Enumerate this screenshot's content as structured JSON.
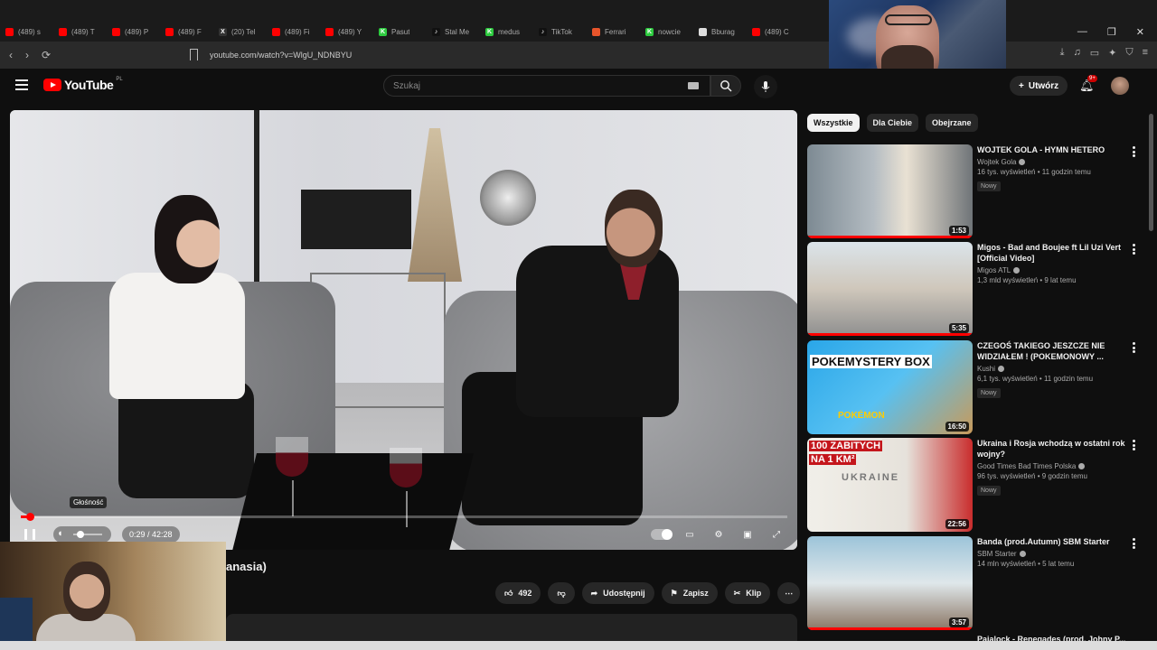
{
  "browser": {
    "tabs": [
      {
        "label": "(489) s",
        "color": "#ff0000"
      },
      {
        "label": "(489) T",
        "color": "#ff0000"
      },
      {
        "label": "(489) P",
        "color": "#ff0000"
      },
      {
        "label": "(489) F",
        "color": "#ff0000"
      },
      {
        "label": "(20) Tel",
        "color": "#333333",
        "glyph": "X"
      },
      {
        "label": "(489) Fi",
        "color": "#ff0000"
      },
      {
        "label": "(489) Y",
        "color": "#ff0000"
      },
      {
        "label": "Pasut",
        "color": "#2ecc40",
        "glyph": "K"
      },
      {
        "label": "Stal Me",
        "color": "#111111",
        "glyph": "♪"
      },
      {
        "label": "medus",
        "color": "#2ecc40",
        "glyph": "K"
      },
      {
        "label": "TikTok",
        "color": "#111111",
        "glyph": "♪"
      },
      {
        "label": "Ferrari",
        "color": "#e8552b"
      },
      {
        "label": "nowcie",
        "color": "#2ecc40",
        "glyph": "K"
      },
      {
        "label": "Bburag",
        "color": "#dddddd"
      },
      {
        "label": "(489) C",
        "color": "#ff0000"
      }
    ],
    "url": "youtube.com/watch?v=WlgU_NDNBYU"
  },
  "header": {
    "logo_text": "YouTube",
    "logo_country": "PL",
    "search_placeholder": "Szukaj",
    "create_label": "Utwórz",
    "notif_count": "9+"
  },
  "player": {
    "time": "0:29 / 42:28",
    "progress_fraction": 0.0114,
    "volume_tooltip": "Głośność"
  },
  "video": {
    "title_fragment": "anasia)",
    "likes": "492",
    "share_label": "Udostępnij",
    "save_label": "Zapisz",
    "clip_label": "Klip"
  },
  "sidebar": {
    "chips": [
      "Wszystkie",
      "Dla Ciebie",
      "Obejrzane"
    ],
    "recs": [
      {
        "title": "WOJTEK GOLA - HYMN HETERO",
        "channel": "Wojtek Gola",
        "meta": "16 tys. wyświetleń • 11 godzin temu",
        "badge": "Nowy",
        "duration": "1:53",
        "watched": 1.0,
        "thumb": "a"
      },
      {
        "title": "Migos - Bad and Boujee ft Lil Uzi Vert [Official Video]",
        "channel": "Migos ATL",
        "meta": "1,3 mld wyświetleń • 9 lat temu",
        "badge": "",
        "duration": "5:35",
        "watched": 1.0,
        "thumb": "b"
      },
      {
        "title": "CZEGOŚ TAKIEGO JESZCZE NIE WIDZIAŁEM ! (POKEMONOWY ...",
        "channel": "Kushi",
        "meta": "6,1 tys. wyświetleń • 11 godzin temu",
        "badge": "Nowy",
        "duration": "16:50",
        "watched": 0,
        "thumb": "c"
      },
      {
        "title": "Ukraina i Rosja wchodzą w ostatni rok wojny?",
        "channel": "Good Times Bad Times Polska",
        "meta": "96 tys. wyświetleń • 9 godzin temu",
        "badge": "Nowy",
        "duration": "22:56",
        "watched": 0,
        "thumb": "d"
      },
      {
        "title": "Banda (prod.Autumn)    SBM Starter",
        "channel": "SBM Starter",
        "meta": "14 mln wyświetleń • 5 lat temu",
        "badge": "",
        "duration": "3:57",
        "watched": 1.0,
        "thumb": "e"
      }
    ],
    "partial_title": "Pajalock - Renegades (prod. Johny P..."
  },
  "thumbs_text": {
    "c_title": "POKEMYSTERY BOX",
    "c_brand": "POKÉMON",
    "d_line1": "100 ZABITYCH",
    "d_line2": "NA 1 KM²",
    "d_map": "UKRAINE"
  }
}
